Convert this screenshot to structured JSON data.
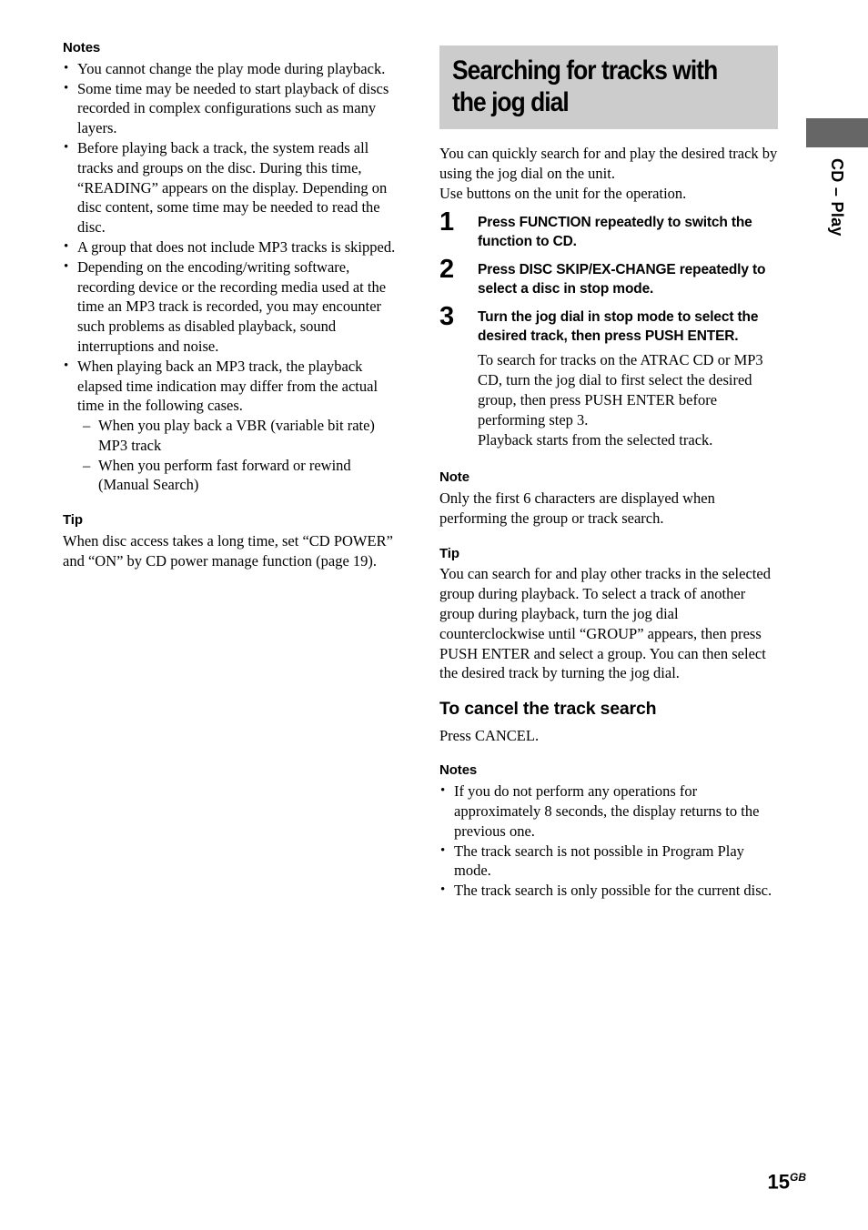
{
  "page": {
    "number": "15",
    "region_suffix": "GB",
    "side_tab_label": "CD – Play",
    "accent_gray": "#666666",
    "banner_gray": "#cccccc"
  },
  "left_column": {
    "notes_heading": "Notes",
    "notes": [
      "You cannot change the play mode during playback.",
      "Some time may be needed to start playback of discs recorded in complex configurations such as many layers.",
      "Before playing back a track, the system reads all tracks and groups on the disc. During this time, “READING” appears on the display. Depending on disc content, some time may be needed to read the disc.",
      "A group that does not include MP3 tracks is skipped.",
      "Depending on the encoding/writing software, recording device or the recording media used at the time an MP3 track is recorded, you may encounter such problems as disabled playback, sound interruptions and noise.",
      "When playing back an MP3 track, the playback elapsed time indication may differ from the actual time in the following cases."
    ],
    "sub_notes": [
      "When you play back a VBR (variable bit rate) MP3 track",
      "When you perform fast forward or rewind (Manual Search)"
    ],
    "tip_heading": "Tip",
    "tip_text": "When disc access takes a long time, set “CD POWER” and “ON” by CD power manage function (page 19)."
  },
  "right_column": {
    "title": "Searching for tracks with\nthe jog dial",
    "intro_line_1": "You can quickly search for and play the desired track by using the jog dial on the unit.",
    "intro_line_2": "Use buttons on the unit for the operation.",
    "steps": [
      {
        "number": "1",
        "text": "Press FUNCTION repeatedly to switch the function to CD."
      },
      {
        "number": "2",
        "text": "Press DISC SKIP/EX-CHANGE repeatedly to select a disc in stop mode."
      },
      {
        "number": "3",
        "text": "Turn the jog dial in stop mode to select the desired track, then press PUSH ENTER.",
        "sub_text": "To search for tracks on the ATRAC CD or MP3 CD, turn the jog dial to first select the desired group, then press PUSH ENTER before performing step 3.",
        "sub_text_2": "Playback starts from the selected track."
      }
    ],
    "note_heading": "Note",
    "note_text": "Only the first 6 characters are displayed when performing the group or track search.",
    "tip_heading": "Tip",
    "tip_text": "You can search for and play other tracks in the selected group during playback. To select a track of another group during playback, turn the jog dial counterclockwise until “GROUP” appears, then press PUSH ENTER and select a group. You can then select the desired track by turning the jog dial.",
    "cancel_heading": "To cancel the track search",
    "cancel_text": "Press CANCEL.",
    "notes_heading": "Notes",
    "notes": [
      "If you do not perform any operations for approximately 8 seconds, the display returns to the previous one.",
      "The track search is not possible in Program Play mode.",
      "The track search is only possible for the current disc."
    ]
  }
}
